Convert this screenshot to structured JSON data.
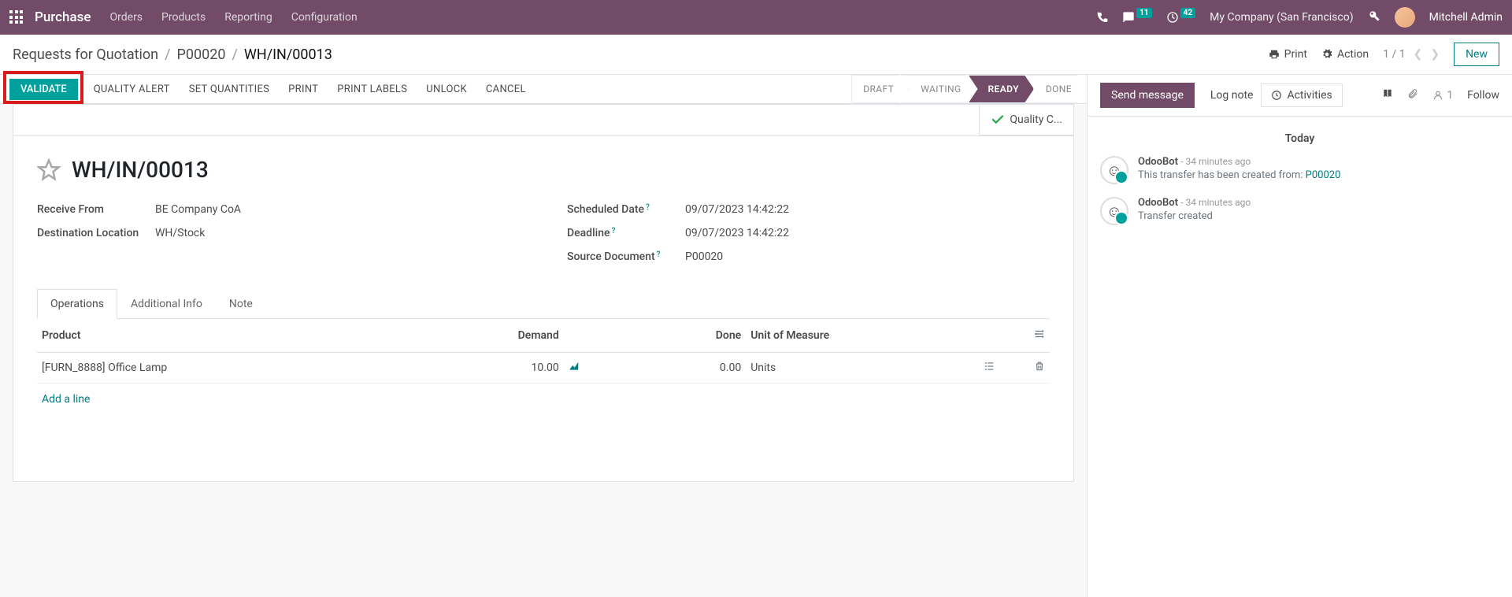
{
  "navbar": {
    "title": "Purchase",
    "menu": [
      "Orders",
      "Products",
      "Reporting",
      "Configuration"
    ],
    "chat_count": "11",
    "activity_count": "42",
    "company": "My Company (San Francisco)",
    "user": "Mitchell Admin"
  },
  "breadcrumb": {
    "root": "Requests for Quotation",
    "parent": "P00020",
    "current": "WH/IN/00013"
  },
  "controls": {
    "print": "Print",
    "action": "Action",
    "pager": "1 / 1",
    "new": "New"
  },
  "actions": {
    "validate": "VALIDATE",
    "quality_alert": "QUALITY ALERT",
    "set_quantities": "SET QUANTITIES",
    "print": "PRINT",
    "print_labels": "PRINT LABELS",
    "unlock": "UNLOCK",
    "cancel": "CANCEL"
  },
  "status_steps": [
    "DRAFT",
    "WAITING",
    "READY",
    "DONE"
  ],
  "status_active_index": 2,
  "quality_check_label": "Quality C...",
  "doc": {
    "name": "WH/IN/00013",
    "receive_from_label": "Receive From",
    "receive_from": "BE Company CoA",
    "dest_label": "Destination Location",
    "dest": "WH/Stock",
    "sched_label": "Scheduled Date",
    "sched": "09/07/2023 14:42:22",
    "deadline_label": "Deadline",
    "deadline": "09/07/2023 14:42:22",
    "srcdoc_label": "Source Document",
    "srcdoc": "P00020"
  },
  "tabs": [
    "Operations",
    "Additional Info",
    "Note"
  ],
  "table": {
    "headers": {
      "product": "Product",
      "demand": "Demand",
      "done": "Done",
      "uom": "Unit of Measure"
    },
    "row": {
      "product": "[FURN_8888] Office Lamp",
      "demand": "10.00",
      "done": "0.00",
      "uom": "Units"
    },
    "add_line": "Add a line"
  },
  "chatter": {
    "send": "Send message",
    "lognote": "Log note",
    "activities": "Activities",
    "followers": "1",
    "follow": "Follow",
    "daysep": "Today",
    "msgs": [
      {
        "name": "OdooBot",
        "time": "- 34 minutes ago",
        "body_prefix": "This transfer has been created from: ",
        "link": "P00020"
      },
      {
        "name": "OdooBot",
        "time": "- 34 minutes ago",
        "body": "Transfer created"
      }
    ]
  }
}
